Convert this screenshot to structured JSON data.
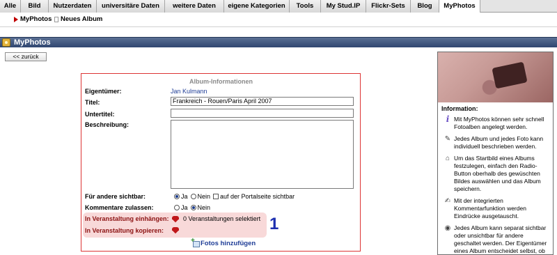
{
  "tabs": [
    {
      "label": "Alle",
      "width": 30
    },
    {
      "label": "Bild",
      "width": 40
    },
    {
      "label": "Nutzerdaten",
      "width": 69
    },
    {
      "label": "universitäre Daten",
      "width": 98
    },
    {
      "label": "weitere Daten",
      "width": 85
    },
    {
      "label": "eigene Kategorien",
      "width": 94
    },
    {
      "label": "Tools",
      "width": 45
    },
    {
      "label": "My Stud.IP",
      "width": 65
    },
    {
      "label": "Flickr-Sets",
      "width": 64
    },
    {
      "label": "Blog",
      "width": 41
    },
    {
      "label": "MyPhotos",
      "width": 59
    }
  ],
  "subtabs": {
    "myphotos": "MyPhotos",
    "new_album": "Neues Album"
  },
  "header": {
    "title": "MyPhotos"
  },
  "back_button": "<< zurück",
  "form": {
    "legend": "Album-Informationen",
    "owner_label": "Eigentümer:",
    "owner_value": "Jan Kulmann",
    "title_label": "Titel:",
    "title_value": "Frankreich - Rouen/Paris April 2007",
    "subtitle_label": "Untertitel:",
    "subtitle_value": "",
    "description_label": "Beschreibung:",
    "visible_label": "Für andere sichtbar:",
    "visible_yes": "Ja",
    "visible_no": "Nein",
    "visible_portal": "auf der Portalseite sichtbar",
    "comments_label": "Kommentare zulassen:",
    "comments_yes": "Ja",
    "comments_no": "Nein",
    "attach_label": "In Veranstaltung einhängen:",
    "attach_value": "0 Veranstaltungen selektiert",
    "copy_label": "In Veranstaltung kopieren:",
    "annotation_number": "1",
    "add_photos": "Fotos hinzufügen"
  },
  "info": {
    "title": "Information:",
    "items": [
      {
        "icon": "info-icon",
        "text": "Mit MyPhotos können sehr schnell Fotoalben angelegt werden."
      },
      {
        "icon": "edit-icon",
        "text": "Jedes Album und jedes Foto kann individuell beschrieben werden."
      },
      {
        "icon": "home-icon",
        "text": "Um das Startbild eines Albums festzulegen, einfach den Radio-Button oberhalb des gewüschten Bildes auswählen und das Album speichern."
      },
      {
        "icon": "comment-icon",
        "text": "Mit der integrierten Kommentarfunktion werden Eindrücke ausgetauscht."
      },
      {
        "icon": "eye-icon",
        "text": "Jedes Album kann separat sichtbar oder unsichtbar für andere geschaltet werden. Der Eigentümer eines Album entscheidet selbst, ob"
      }
    ]
  }
}
